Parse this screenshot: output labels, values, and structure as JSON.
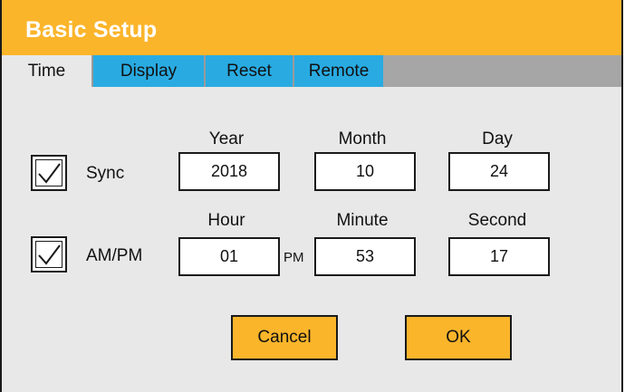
{
  "window": {
    "title": "Basic Setup"
  },
  "tabs": [
    {
      "label": "Time",
      "active": true
    },
    {
      "label": "Display",
      "active": false
    },
    {
      "label": "Reset",
      "active": false
    },
    {
      "label": "Remote",
      "active": false
    }
  ],
  "sync": {
    "label": "Sync",
    "checked": true
  },
  "ampm": {
    "label": "AM/PM",
    "checked": true,
    "indicator": "PM"
  },
  "date": {
    "year": {
      "label": "Year",
      "value": "2018"
    },
    "month": {
      "label": "Month",
      "value": "10"
    },
    "day": {
      "label": "Day",
      "value": "24"
    }
  },
  "time": {
    "hour": {
      "label": "Hour",
      "value": "01"
    },
    "minute": {
      "label": "Minute",
      "value": "53"
    },
    "second": {
      "label": "Second",
      "value": "17"
    }
  },
  "buttons": {
    "cancel": "Cancel",
    "ok": "OK"
  },
  "colors": {
    "accent": "#fbb52b",
    "tab_inactive": "#29abe2",
    "tab_bar": "#a6a6a6",
    "panel": "#e8e8e8"
  },
  "icons": {
    "check": "checkmark-icon"
  }
}
